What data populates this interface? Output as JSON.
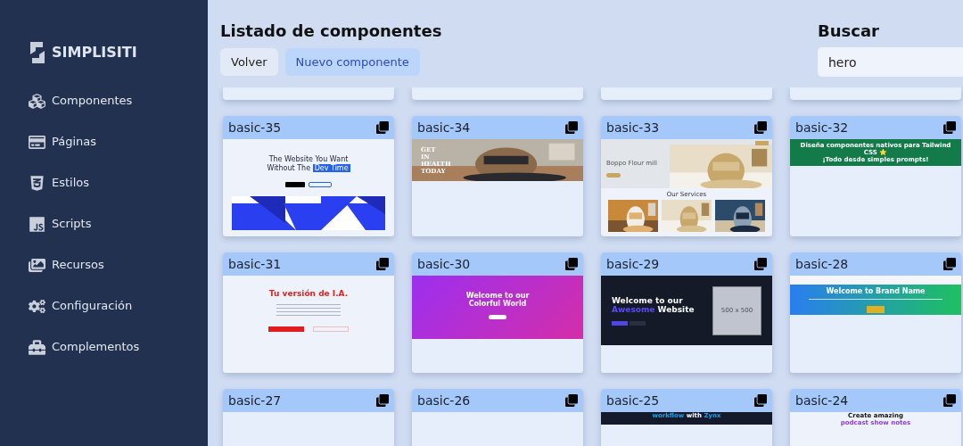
{
  "brand": {
    "name": "SIMPLISITI"
  },
  "sidebar": {
    "items": [
      {
        "label": "Componentes"
      },
      {
        "label": "Páginas"
      },
      {
        "label": "Estilos"
      },
      {
        "label": "Scripts"
      },
      {
        "label": "Recursos"
      },
      {
        "label": "Configuración"
      },
      {
        "label": "Complementos"
      }
    ]
  },
  "header": {
    "title": "Listado de componentes",
    "buttons": [
      {
        "label": "Volver",
        "kind": "plain"
      },
      {
        "label": "Nuevo componente",
        "kind": "primary"
      }
    ]
  },
  "search": {
    "label": "Buscar",
    "value": "hero"
  },
  "components": [
    {
      "name": "basic-35",
      "preview": {
        "kind": "geometric",
        "lines": [
          "The Website You Want",
          "Without The"
        ],
        "highlight": "Dev Time"
      }
    },
    {
      "name": "basic-34",
      "preview": {
        "kind": "photo-hero",
        "lines": [
          "GET",
          "IN",
          "HEALTH",
          "TODAY"
        ]
      }
    },
    {
      "name": "basic-33",
      "preview": {
        "kind": "mill",
        "lines": [
          "Boppo Flour mill",
          "Our Services"
        ]
      }
    },
    {
      "name": "basic-32",
      "preview": {
        "kind": "green-banner",
        "lines": [
          "Diseña componentes nativos para Tailwind CSS ⭐",
          "¡Todo desde simples prompts!"
        ]
      }
    },
    {
      "name": "basic-31",
      "preview": {
        "kind": "ai",
        "lines": [
          "Tu versión de I.A."
        ]
      }
    },
    {
      "name": "basic-30",
      "preview": {
        "kind": "gradient",
        "lines": [
          "Welcome to our",
          "Colorful World"
        ]
      }
    },
    {
      "name": "basic-29",
      "preview": {
        "kind": "dark-split",
        "lines": [
          "Welcome to our",
          "Website",
          "500 x 500"
        ],
        "highlight": "Awesome"
      }
    },
    {
      "name": "basic-28",
      "preview": {
        "kind": "brand",
        "lines": [
          "Welcome to Brand Name"
        ]
      }
    },
    {
      "name": "basic-27",
      "preview": {
        "kind": "blank"
      }
    },
    {
      "name": "basic-26",
      "preview": {
        "kind": "blank"
      }
    },
    {
      "name": "basic-25",
      "preview": {
        "kind": "dark-strip",
        "lines": [
          "workflow",
          "with"
        ],
        "highlight": "Zynx"
      }
    },
    {
      "name": "basic-24",
      "preview": {
        "kind": "podcast",
        "lines": [
          "Create amazing",
          "podcast show notes"
        ]
      }
    }
  ]
}
